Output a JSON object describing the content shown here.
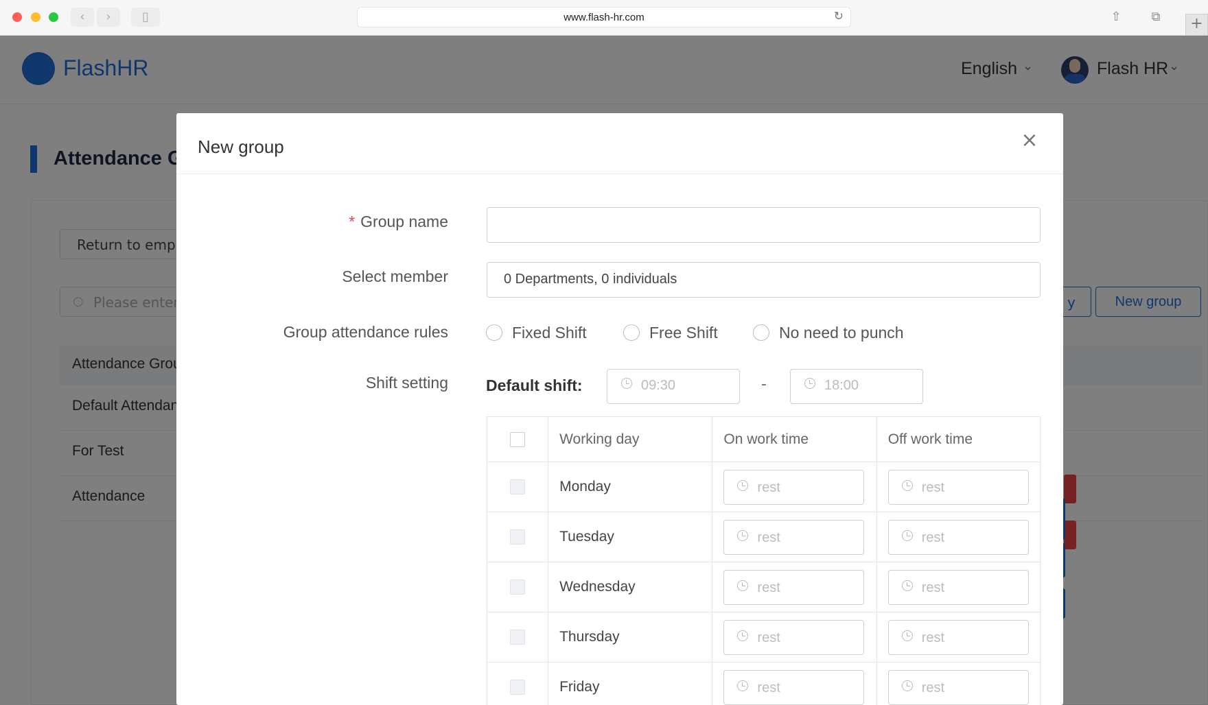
{
  "browser": {
    "url": "www.flash-hr.com"
  },
  "app": {
    "brand": "FlashHR",
    "language": "English",
    "user_name": "Flash HR"
  },
  "background_page": {
    "section_title": "Attendance G",
    "return_button": "Return to emplo",
    "search_placeholder": "Please enter",
    "partial_button": "y",
    "new_group_button": "New group",
    "table_header": "Attendance Grou",
    "rows": [
      "Default Attendan",
      "For Test",
      "Attendance"
    ]
  },
  "modal": {
    "title": "New group",
    "labels": {
      "group_name": "Group name",
      "select_member": "Select member",
      "attendance_rules": "Group attendance rules",
      "shift_setting": "Shift setting"
    },
    "group_name_value": "",
    "select_member_value": "0 Departments, 0 individuals",
    "rules": [
      "Fixed Shift",
      "Free Shift",
      "No need to punch"
    ],
    "default_shift_label": "Default shift:",
    "default_shift_start": "09:30",
    "default_shift_end": "18:00",
    "table_headers": {
      "working_day": "Working day",
      "on_work_time": "On work time",
      "off_work_time": "Off work time"
    },
    "days": [
      {
        "name": "Monday",
        "on": "rest",
        "off": "rest"
      },
      {
        "name": "Tuesday",
        "on": "rest",
        "off": "rest"
      },
      {
        "name": "Wednesday",
        "on": "rest",
        "off": "rest"
      },
      {
        "name": "Thursday",
        "on": "rest",
        "off": "rest"
      },
      {
        "name": "Friday",
        "on": "rest",
        "off": "rest"
      }
    ]
  },
  "colors": {
    "brand_blue": "#1f6fd6",
    "required_red": "#e5434d",
    "overlay": "rgba(0,0,0,0.5)"
  }
}
